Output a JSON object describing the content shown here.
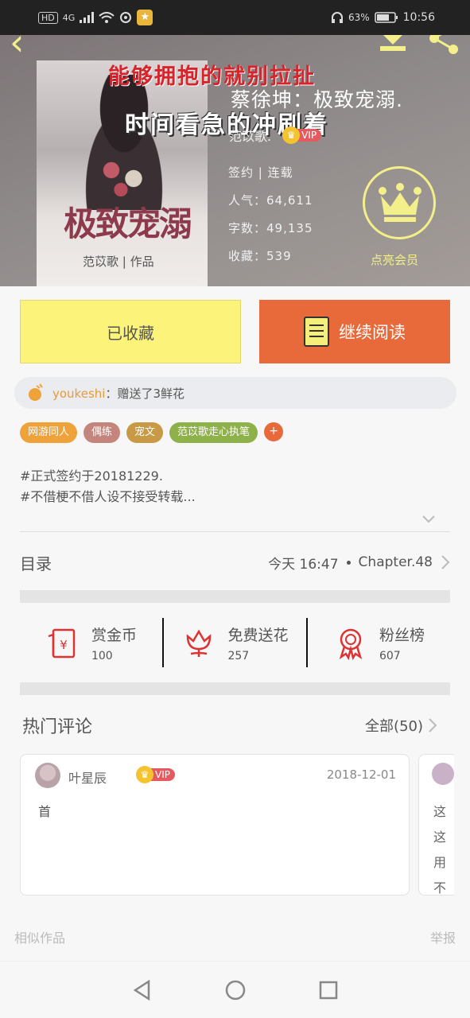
{
  "status_bar": {
    "hd": "HD",
    "network": "4G",
    "battery": "63%",
    "time": "10:56"
  },
  "book": {
    "cover_title": "极致宠溺",
    "cover_author": "范苡歌 | 作品",
    "overlay_1": "能够拥抱的就别拉扯",
    "overlay_2": "蔡徐坤：极致宠溺.",
    "overlay_3": "时间看急的冲刷着",
    "author": "范苡歌.",
    "vip": "VIP",
    "signed": "签约 | 连载",
    "popularity": "人气：64,611",
    "word_count": "字数：49,135",
    "favorites": "收藏：539",
    "member_label": "点亮会员"
  },
  "actions": {
    "collected": "已收藏",
    "continue_reading": "继续阅读"
  },
  "gift_banner": {
    "user": "youkeshi",
    "text": "：赠送了3鲜花"
  },
  "tags": [
    {
      "label": "网游同人",
      "color": "#f0a23a"
    },
    {
      "label": "偶练",
      "color": "#c4857c"
    },
    {
      "label": "宠文",
      "color": "#c99a45"
    },
    {
      "label": "范苡歌走心执笔",
      "color": "#8fb14a"
    }
  ],
  "tag_more": "+",
  "description": [
    "#正式签约于20181229.",
    "#不借梗不借人设不接受转载..."
  ],
  "toc": {
    "label": "目录",
    "updated": "今天 16:47",
    "chapter": "Chapter.48"
  },
  "stats": [
    {
      "label": "赏金币",
      "value": "100"
    },
    {
      "label": "免费送花",
      "value": "257"
    },
    {
      "label": "粉丝榜",
      "value": "607"
    }
  ],
  "hot_comments": {
    "title": "热门评论",
    "all": "全部(50)",
    "items": [
      {
        "user": "叶星辰",
        "vip": "VIP",
        "date": "2018-12-01",
        "text": "首"
      }
    ],
    "peek_text": "这这用不"
  },
  "footer": {
    "similar": "相似作品",
    "report": "举报"
  }
}
